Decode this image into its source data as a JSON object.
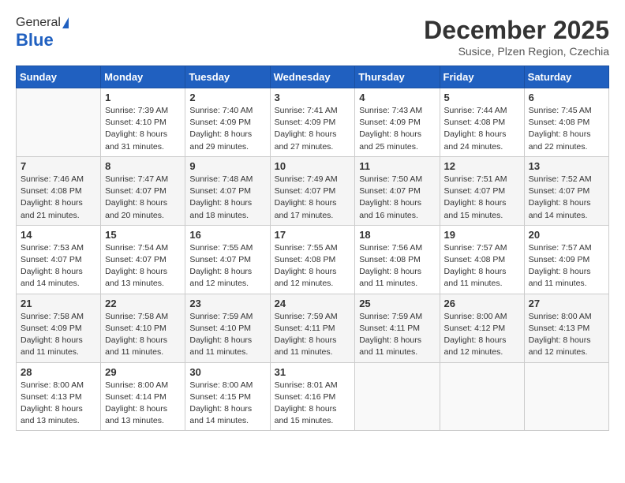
{
  "header": {
    "logo_general": "General",
    "logo_blue": "Blue",
    "title": "December 2025",
    "subtitle": "Susice, Plzen Region, Czechia"
  },
  "calendar": {
    "weekdays": [
      "Sunday",
      "Monday",
      "Tuesday",
      "Wednesday",
      "Thursday",
      "Friday",
      "Saturday"
    ],
    "weeks": [
      [
        {
          "day": "",
          "info": ""
        },
        {
          "day": "1",
          "info": "Sunrise: 7:39 AM\nSunset: 4:10 PM\nDaylight: 8 hours\nand 31 minutes."
        },
        {
          "day": "2",
          "info": "Sunrise: 7:40 AM\nSunset: 4:09 PM\nDaylight: 8 hours\nand 29 minutes."
        },
        {
          "day": "3",
          "info": "Sunrise: 7:41 AM\nSunset: 4:09 PM\nDaylight: 8 hours\nand 27 minutes."
        },
        {
          "day": "4",
          "info": "Sunrise: 7:43 AM\nSunset: 4:09 PM\nDaylight: 8 hours\nand 25 minutes."
        },
        {
          "day": "5",
          "info": "Sunrise: 7:44 AM\nSunset: 4:08 PM\nDaylight: 8 hours\nand 24 minutes."
        },
        {
          "day": "6",
          "info": "Sunrise: 7:45 AM\nSunset: 4:08 PM\nDaylight: 8 hours\nand 22 minutes."
        }
      ],
      [
        {
          "day": "7",
          "info": "Sunrise: 7:46 AM\nSunset: 4:08 PM\nDaylight: 8 hours\nand 21 minutes."
        },
        {
          "day": "8",
          "info": "Sunrise: 7:47 AM\nSunset: 4:07 PM\nDaylight: 8 hours\nand 20 minutes."
        },
        {
          "day": "9",
          "info": "Sunrise: 7:48 AM\nSunset: 4:07 PM\nDaylight: 8 hours\nand 18 minutes."
        },
        {
          "day": "10",
          "info": "Sunrise: 7:49 AM\nSunset: 4:07 PM\nDaylight: 8 hours\nand 17 minutes."
        },
        {
          "day": "11",
          "info": "Sunrise: 7:50 AM\nSunset: 4:07 PM\nDaylight: 8 hours\nand 16 minutes."
        },
        {
          "day": "12",
          "info": "Sunrise: 7:51 AM\nSunset: 4:07 PM\nDaylight: 8 hours\nand 15 minutes."
        },
        {
          "day": "13",
          "info": "Sunrise: 7:52 AM\nSunset: 4:07 PM\nDaylight: 8 hours\nand 14 minutes."
        }
      ],
      [
        {
          "day": "14",
          "info": "Sunrise: 7:53 AM\nSunset: 4:07 PM\nDaylight: 8 hours\nand 14 minutes."
        },
        {
          "day": "15",
          "info": "Sunrise: 7:54 AM\nSunset: 4:07 PM\nDaylight: 8 hours\nand 13 minutes."
        },
        {
          "day": "16",
          "info": "Sunrise: 7:55 AM\nSunset: 4:07 PM\nDaylight: 8 hours\nand 12 minutes."
        },
        {
          "day": "17",
          "info": "Sunrise: 7:55 AM\nSunset: 4:08 PM\nDaylight: 8 hours\nand 12 minutes."
        },
        {
          "day": "18",
          "info": "Sunrise: 7:56 AM\nSunset: 4:08 PM\nDaylight: 8 hours\nand 11 minutes."
        },
        {
          "day": "19",
          "info": "Sunrise: 7:57 AM\nSunset: 4:08 PM\nDaylight: 8 hours\nand 11 minutes."
        },
        {
          "day": "20",
          "info": "Sunrise: 7:57 AM\nSunset: 4:09 PM\nDaylight: 8 hours\nand 11 minutes."
        }
      ],
      [
        {
          "day": "21",
          "info": "Sunrise: 7:58 AM\nSunset: 4:09 PM\nDaylight: 8 hours\nand 11 minutes."
        },
        {
          "day": "22",
          "info": "Sunrise: 7:58 AM\nSunset: 4:10 PM\nDaylight: 8 hours\nand 11 minutes."
        },
        {
          "day": "23",
          "info": "Sunrise: 7:59 AM\nSunset: 4:10 PM\nDaylight: 8 hours\nand 11 minutes."
        },
        {
          "day": "24",
          "info": "Sunrise: 7:59 AM\nSunset: 4:11 PM\nDaylight: 8 hours\nand 11 minutes."
        },
        {
          "day": "25",
          "info": "Sunrise: 7:59 AM\nSunset: 4:11 PM\nDaylight: 8 hours\nand 11 minutes."
        },
        {
          "day": "26",
          "info": "Sunrise: 8:00 AM\nSunset: 4:12 PM\nDaylight: 8 hours\nand 12 minutes."
        },
        {
          "day": "27",
          "info": "Sunrise: 8:00 AM\nSunset: 4:13 PM\nDaylight: 8 hours\nand 12 minutes."
        }
      ],
      [
        {
          "day": "28",
          "info": "Sunrise: 8:00 AM\nSunset: 4:13 PM\nDaylight: 8 hours\nand 13 minutes."
        },
        {
          "day": "29",
          "info": "Sunrise: 8:00 AM\nSunset: 4:14 PM\nDaylight: 8 hours\nand 13 minutes."
        },
        {
          "day": "30",
          "info": "Sunrise: 8:00 AM\nSunset: 4:15 PM\nDaylight: 8 hours\nand 14 minutes."
        },
        {
          "day": "31",
          "info": "Sunrise: 8:01 AM\nSunset: 4:16 PM\nDaylight: 8 hours\nand 15 minutes."
        },
        {
          "day": "",
          "info": ""
        },
        {
          "day": "",
          "info": ""
        },
        {
          "day": "",
          "info": ""
        }
      ]
    ]
  }
}
